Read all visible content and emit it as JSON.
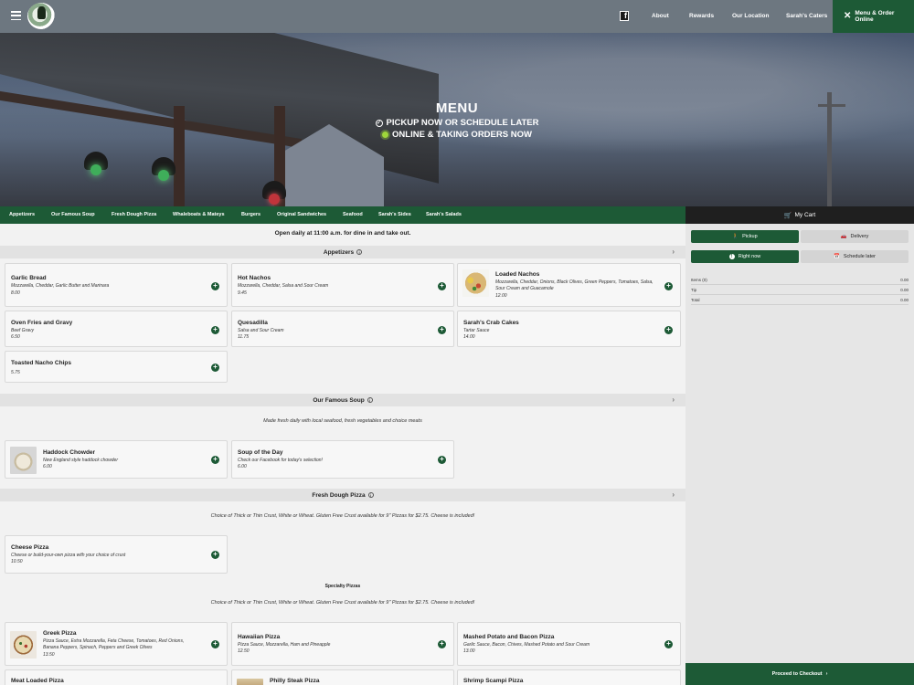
{
  "header": {
    "nav": [
      "About",
      "Rewards",
      "Our Location",
      "Sarah's Caters"
    ],
    "order_button": "Menu & Order Online"
  },
  "hero": {
    "title": "MENU",
    "line1": "PICKUP NOW OR SCHEDULE LATER",
    "line2": "ONLINE & TAKING ORDERS NOW"
  },
  "categories": [
    "Appetizers",
    "Our Famous Soup",
    "Fresh Dough Pizza",
    "Whaleboats & Mateys",
    "Burgers",
    "Original Sandwiches",
    "Seafood",
    "Sarah's Sides",
    "Sarah's Salads"
  ],
  "menu": {
    "hours": "Open daily at 11:00 a.m. for dine in and take out.",
    "appetizers": {
      "title": "Appetizers",
      "items": [
        {
          "name": "Garlic Bread",
          "desc": "Mozzarella, Cheddar, Garlic Butter and Marinara",
          "price": "8.00"
        },
        {
          "name": "Hot Nachos",
          "desc": "Mozzarella, Cheddar, Salsa and Sour Cream",
          "price": "9.45"
        },
        {
          "name": "Loaded Nachos",
          "desc": "Mozzarella, Cheddar, Onions, Black Olives, Green Peppers, Tomatoes, Salsa, Sour Cream and Guacamole",
          "price": "12.00"
        },
        {
          "name": "Oven Fries and Gravy",
          "desc": "Beef Gravy",
          "price": "6.50"
        },
        {
          "name": "Quesadilla",
          "desc": "Salsa and Sour Cream",
          "price": "11.75"
        },
        {
          "name": "Sarah's Crab Cakes",
          "desc": "Tartar Sauce",
          "price": "14.00"
        },
        {
          "name": "Toasted Nacho Chips",
          "desc": "",
          "price": "5.75"
        }
      ]
    },
    "soup": {
      "title": "Our Famous Soup",
      "note": "Made fresh daily with local seafood, fresh vegetables and choice meats",
      "items": [
        {
          "name": "Haddock Chowder",
          "desc": "New England style haddock chowder",
          "price": "6.00"
        },
        {
          "name": "Soup of the Day",
          "desc": "Check our Facebook for today's selection!",
          "price": "6.00"
        }
      ]
    },
    "pizza": {
      "title": "Fresh Dough Pizza",
      "note": "Choice of Thick or Thin Crust, White or Wheat. Gluten Free Crust available for 9\" Pizzas for $2.75. Cheese is included!",
      "items": [
        {
          "name": "Cheese Pizza",
          "desc": "Cheese or build-your-own pizza with your choice of crust",
          "price": "10.50"
        }
      ],
      "specialty_title": "Specialty Pizzas",
      "specialty_note": "Choice of Thick or Thin Crust, White or Wheat. Gluten Free Crust available for 9\" Pizzas for $2.75. Cheese is included!",
      "specialty": [
        {
          "name": "Greek Pizza",
          "desc": "Pizza Sauce, Extra Mozzarella, Feta Cheese, Tomatoes, Red Onions, Banana Peppers, Spinach, Peppers and Greek Olives",
          "price": "13.50"
        },
        {
          "name": "Hawaiian Pizza",
          "desc": "Pizza Sauce, Mozzarella, Ham and Pineapple",
          "price": "12.50"
        },
        {
          "name": "Mashed Potato and Bacon Pizza",
          "desc": "Garlic Sauce, Bacon, Chives, Mashed Potato and Sour Cream",
          "price": "13.00"
        },
        {
          "name": "Meat Loaded Pizza"
        },
        {
          "name": "Philly Steak Pizza"
        },
        {
          "name": "Shrimp Scampi Pizza"
        }
      ]
    }
  },
  "cart": {
    "title": "My Cart",
    "pickup": "Pickup",
    "delivery": "Delivery",
    "right_now": "Right now",
    "schedule": "Schedule later",
    "rows": [
      {
        "label": "Items (0)",
        "value": "0.00"
      },
      {
        "label": "Tip",
        "value": "0.00"
      },
      {
        "label": "Total",
        "value": "0.00"
      }
    ],
    "checkout": "Proceed to Checkout"
  },
  "colors": {
    "brand_green": "#1d5a36",
    "header_gray": "#6d7780",
    "cart_dark": "#1f1f1f"
  }
}
